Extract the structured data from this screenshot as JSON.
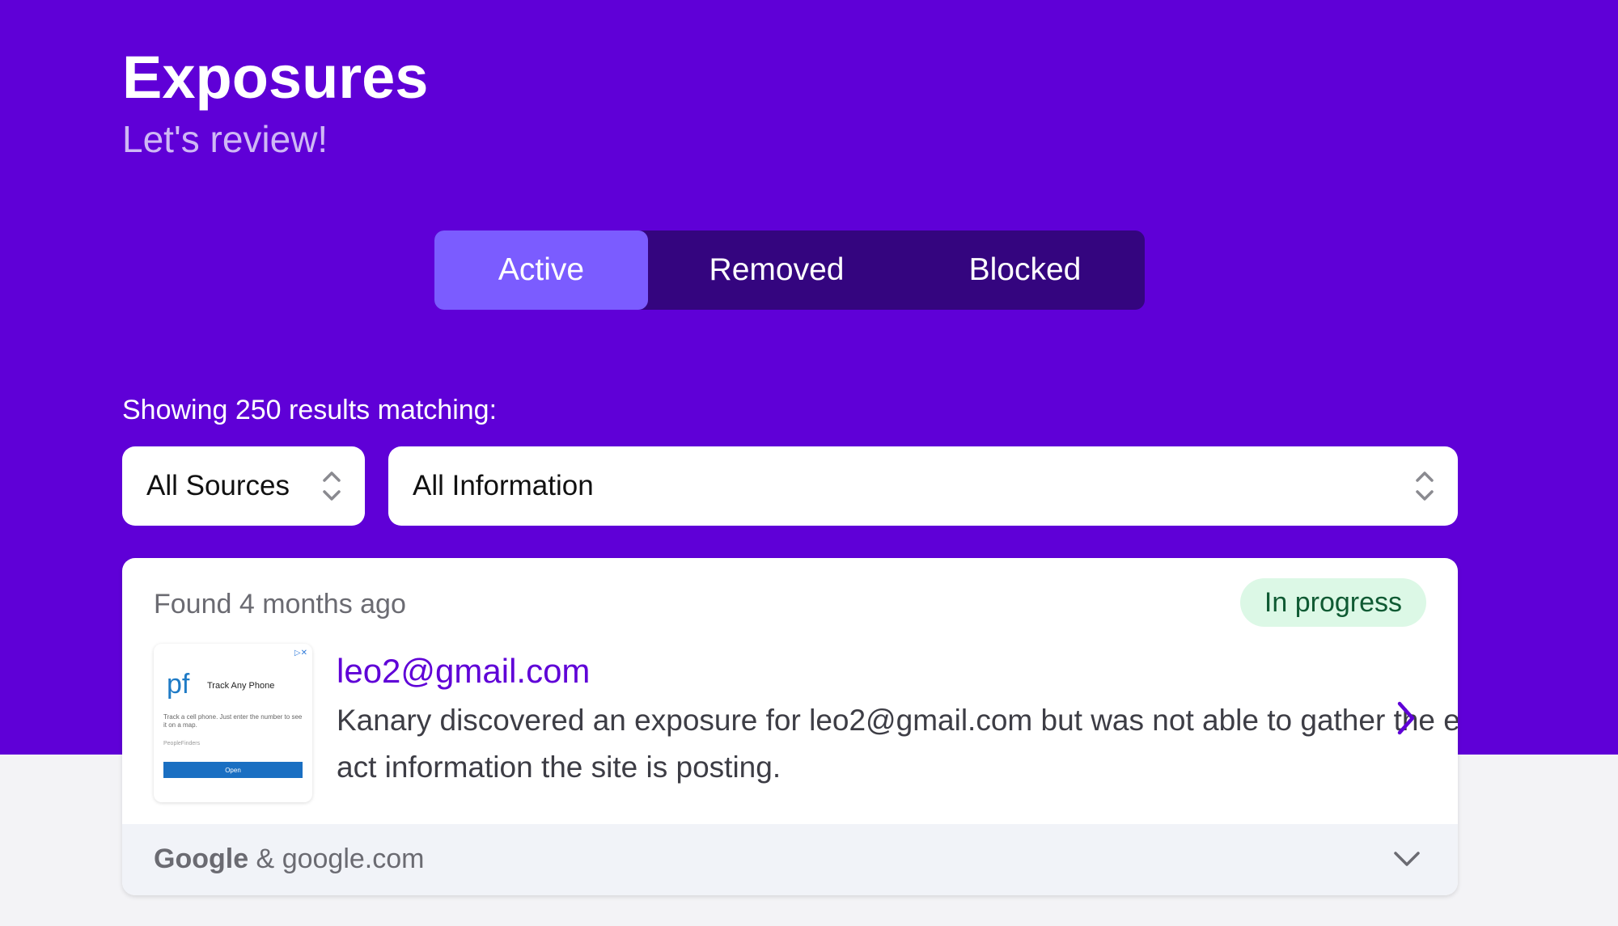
{
  "header": {
    "title": "Exposures",
    "subtitle": "Let's review!"
  },
  "tabs": [
    {
      "label": "Active",
      "active": true
    },
    {
      "label": "Removed",
      "active": false
    },
    {
      "label": "Blocked",
      "active": false
    }
  ],
  "filters": {
    "results_text": "Showing 250 results matching:",
    "sources_select": "All Sources",
    "information_select": "All Information"
  },
  "exposure": {
    "found": "Found 4 months ago",
    "status": "In progress",
    "title": "leo2@gmail.com",
    "description": "Kanary discovered an exposure for leo2@gmail.com but was not able to gather the exact information the site is posting.",
    "source_name": "Google",
    "source_separator": " & ",
    "source_domain": "google.com",
    "thumbnail": {
      "ad_mark": "▷✕",
      "logo": "pf",
      "ad_title": "Track Any Phone",
      "ad_text": "Track a cell phone. Just enter the number to see it on a map.",
      "ad_brand": "PeopleFinders",
      "ad_button": "Open"
    }
  },
  "colors": {
    "brand": "#5f00d7",
    "tab_active": "#7b5cff",
    "tab_bar": "#34057f",
    "badge_bg": "#dcf8e6",
    "badge_text": "#0f5a33"
  },
  "icons": {
    "select_arrow": "updown-chevron-icon",
    "open": "chevron-right-icon",
    "expand": "chevron-down-icon"
  }
}
